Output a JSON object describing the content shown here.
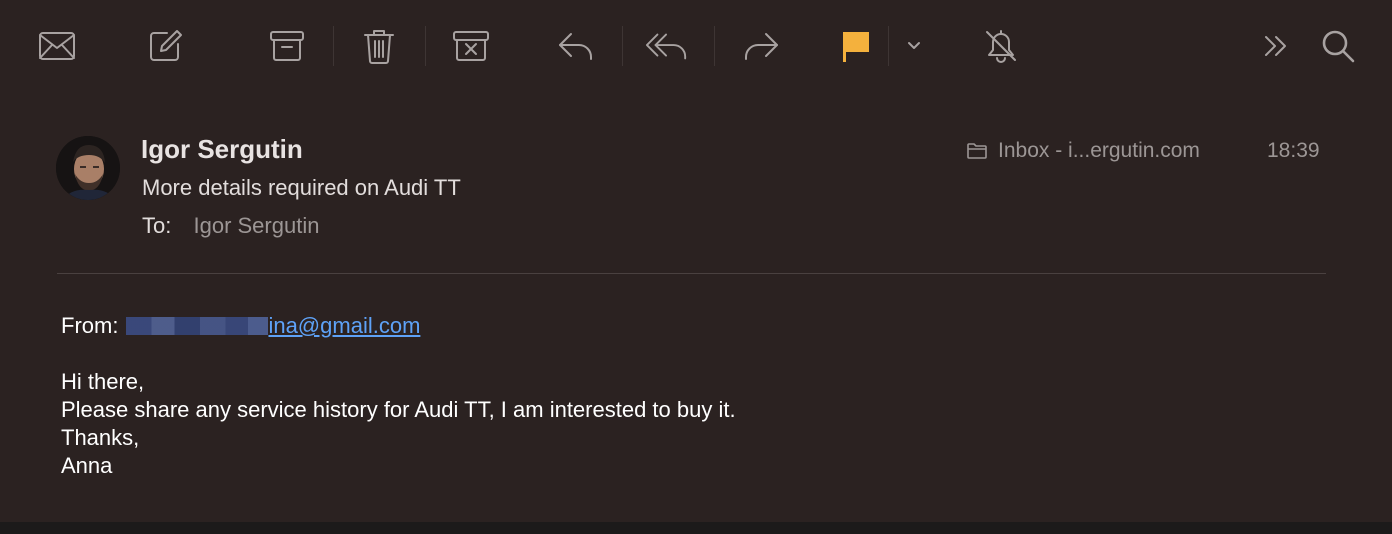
{
  "toolbar": {
    "buttons": [
      {
        "name": "get-mail",
        "icon": "envelope-icon"
      },
      {
        "name": "compose",
        "icon": "compose-icon"
      },
      {
        "name": "archive",
        "icon": "archive-icon"
      },
      {
        "name": "delete",
        "icon": "trash-icon"
      },
      {
        "name": "junk",
        "icon": "junk-icon"
      },
      {
        "name": "reply",
        "icon": "reply-icon"
      },
      {
        "name": "reply-all",
        "icon": "reply-all-icon"
      },
      {
        "name": "forward",
        "icon": "forward-icon"
      },
      {
        "name": "flag",
        "icon": "flag-icon",
        "color": "#f4b13d"
      },
      {
        "name": "flag-menu",
        "icon": "chevron-down-icon"
      },
      {
        "name": "mute",
        "icon": "bell-slash-icon"
      },
      {
        "name": "more",
        "icon": "double-chevron-right-icon"
      },
      {
        "name": "search",
        "icon": "search-icon"
      }
    ]
  },
  "message": {
    "sender_name": "Igor Sergutin",
    "subject": "More details required on Audi TT",
    "to_label": "To:",
    "to_value": "Igor Sergutin",
    "mailbox": "Inbox - i...ergutin.com",
    "time": "18:39"
  },
  "body": {
    "from_label": "From:",
    "from_email_visible": "ina@gmail.com",
    "lines": [
      "Hi there,",
      "Please share any service history for Audi TT, I am interested to buy it.",
      "Thanks,",
      "Anna"
    ]
  },
  "colors": {
    "background": "#2b2221",
    "link": "#5ea2f7",
    "flag": "#f4b13d",
    "icon": "#a8a2a1"
  }
}
